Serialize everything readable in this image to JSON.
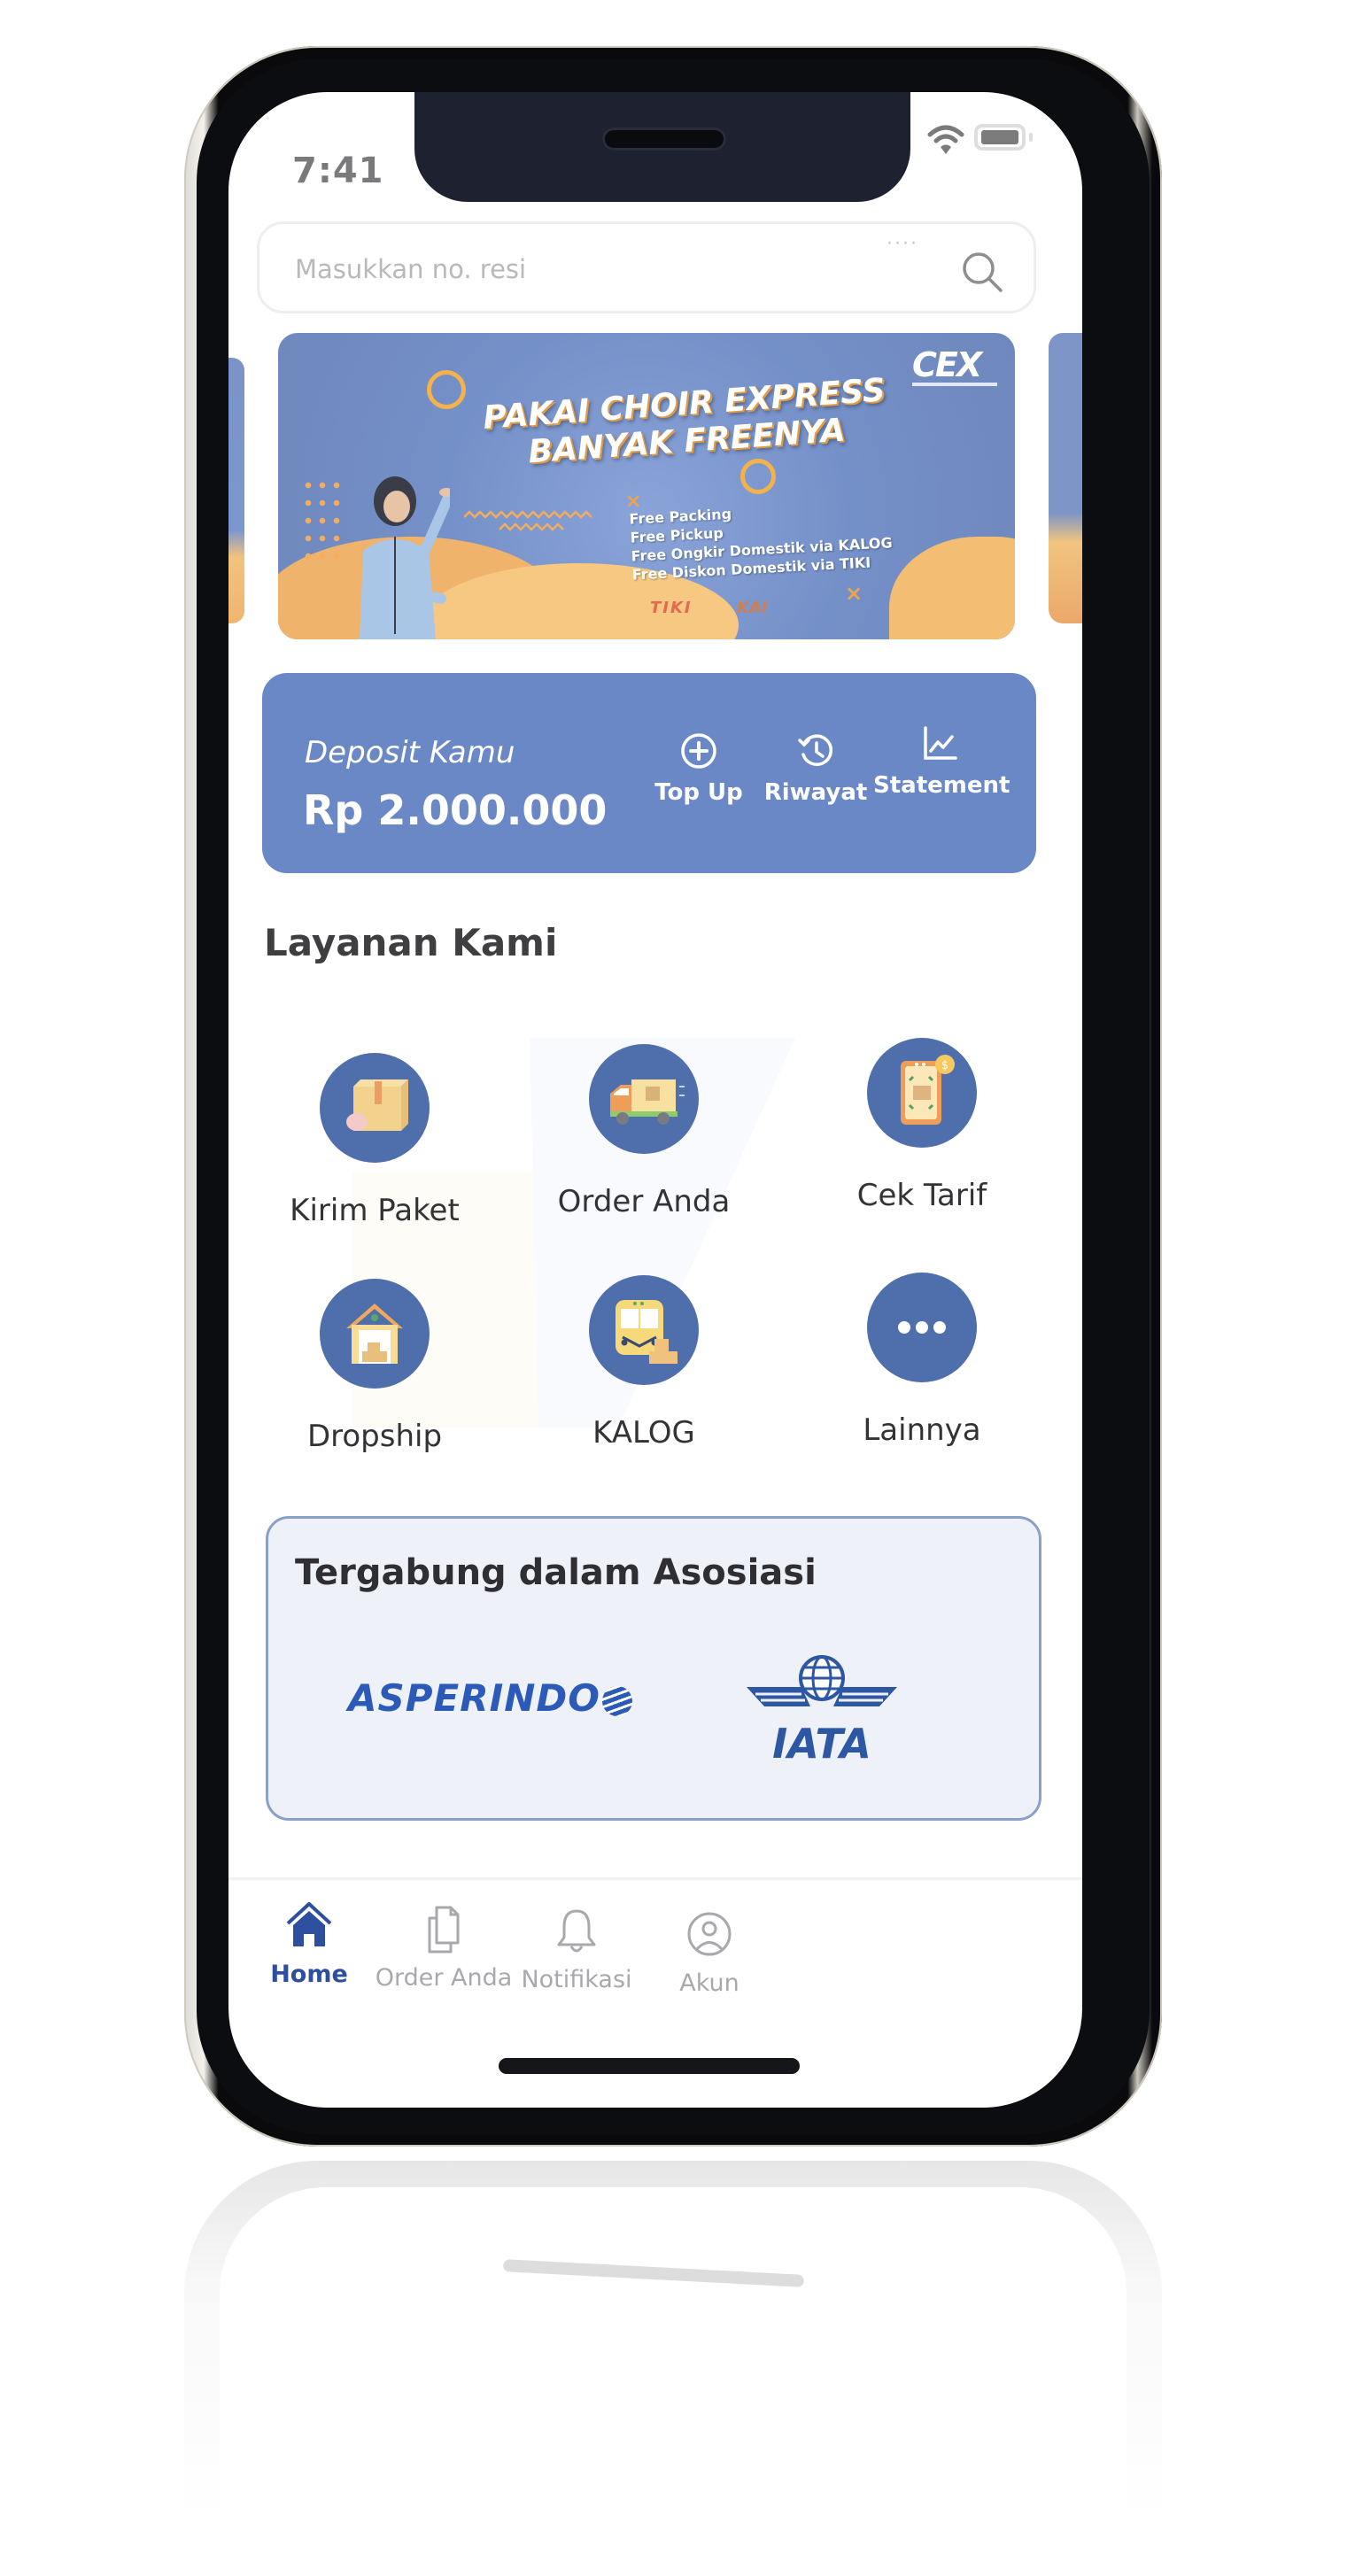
{
  "status_bar": {
    "time": "7:41",
    "icons": [
      "wifi-icon",
      "battery-icon"
    ]
  },
  "search": {
    "placeholder": "Masukkan no. resi",
    "value": "",
    "decoration": "····",
    "icon": "search-icon"
  },
  "banner": {
    "brand": "CEX",
    "title_line1": "PAKAI CHOIR EXPRESS",
    "title_line2": "BANYAK FREENYA",
    "features": [
      "Free Packing",
      "Free Pickup",
      "Free Ongkir Domestik via KALOG",
      "Free Diskon Domestik via TIKI"
    ],
    "partner_logos": [
      "TIKI",
      "KAI"
    ]
  },
  "deposit": {
    "label": "Deposit Kamu",
    "amount": "Rp 2.000.000",
    "actions": [
      {
        "label": "Top Up",
        "icon": "plus-circle-icon"
      },
      {
        "label": "Riwayat",
        "icon": "history-icon"
      },
      {
        "label": "Statement",
        "icon": "chart-line-icon"
      }
    ]
  },
  "services": {
    "title": "Layanan Kami",
    "items": [
      {
        "label": "Kirim Paket",
        "icon": "package-icon"
      },
      {
        "label": "Order Anda",
        "icon": "truck-icon"
      },
      {
        "label": "Cek Tarif",
        "icon": "phone-tariff-icon"
      },
      {
        "label": "Dropship",
        "icon": "warehouse-icon"
      },
      {
        "label": "KALOG",
        "icon": "train-icon"
      },
      {
        "label": "Lainnya",
        "icon": "more-icon"
      }
    ]
  },
  "association": {
    "title": "Tergabung dalam Asosiasi",
    "logos": [
      "ASPERINDO",
      "IATA"
    ]
  },
  "bottom_nav": {
    "items": [
      {
        "label": "Home",
        "icon": "home-icon",
        "active": true
      },
      {
        "label": "Order Anda",
        "icon": "documents-icon",
        "active": false
      },
      {
        "label": "Notifikasi",
        "icon": "bell-icon",
        "active": false
      },
      {
        "label": "Akun",
        "icon": "user-circle-icon",
        "active": false
      }
    ]
  },
  "colors": {
    "primary": "#6a87c6",
    "icon_circle": "#4f6eac",
    "nav_active": "#2e4f9e",
    "nav_inactive": "#a8a9ad",
    "accent_orange": "#f3b24a"
  }
}
